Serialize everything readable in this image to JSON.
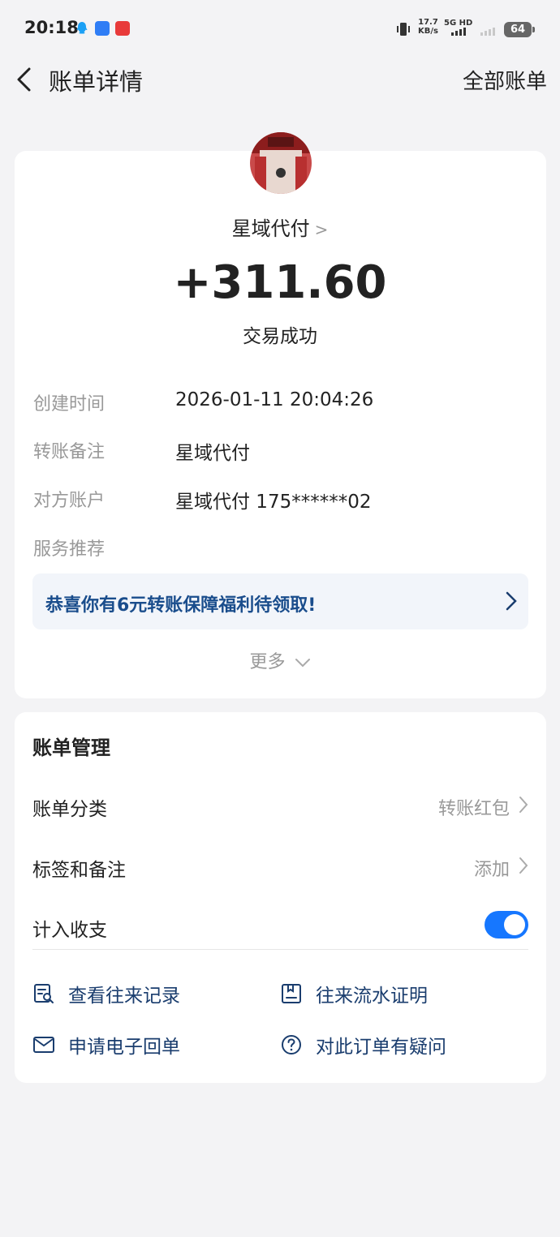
{
  "status_bar": {
    "time": "20:18",
    "net_speed": "17.7",
    "net_unit": "KB/s",
    "net_type": "5G HD",
    "battery": "64"
  },
  "nav": {
    "title": "账单详情",
    "right_link": "全部账单"
  },
  "transaction": {
    "payee": "星域代付",
    "amount": "+311.60",
    "status": "交易成功"
  },
  "details": {
    "created_label": "创建时间",
    "created_value": "2026-01-11 20:04:26",
    "note_label": "转账备注",
    "note_value": "星域代付",
    "account_label": "对方账户",
    "account_value": "星域代付 175******02",
    "service_label": "服务推荐"
  },
  "promo": {
    "text": "恭喜你有6元转账保障福利待领取!"
  },
  "more": "更多",
  "management": {
    "title": "账单管理",
    "category_label": "账单分类",
    "category_value": "转账红包",
    "tags_label": "标签和备注",
    "tags_value": "添加",
    "count_label": "计入收支",
    "count_enabled": true
  },
  "actions": {
    "history": "查看往来记录",
    "statement": "往来流水证明",
    "receipt": "申请电子回单",
    "question": "对此订单有疑问"
  },
  "colors": {
    "accent": "#1677ff",
    "link": "#1a3d6e",
    "promo_text": "#1a4d8c",
    "background": "#f3f3f5"
  }
}
